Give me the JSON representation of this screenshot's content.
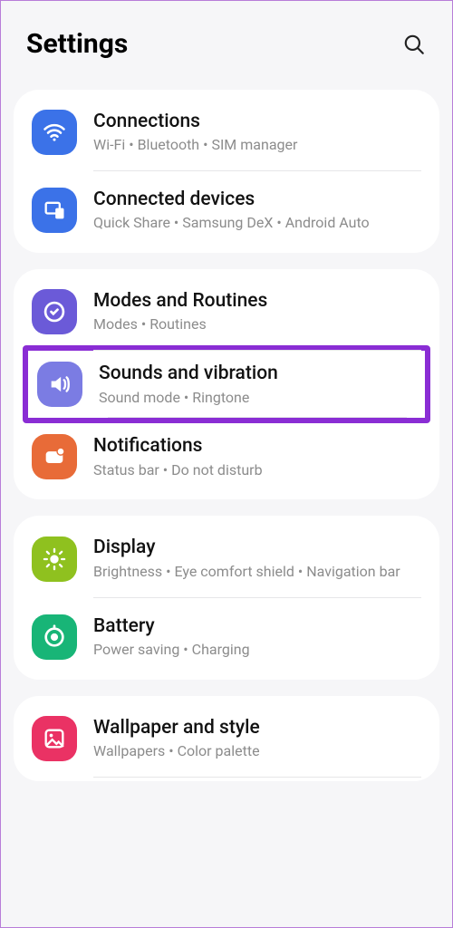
{
  "header": {
    "title": "Settings"
  },
  "groups": [
    {
      "items": [
        {
          "title": "Connections",
          "subtitle": "Wi-Fi  •  Bluetooth  •  SIM manager"
        },
        {
          "title": "Connected devices",
          "subtitle": "Quick Share  •  Samsung DeX  •  Android Auto"
        }
      ]
    },
    {
      "items": [
        {
          "title": "Modes and Routines",
          "subtitle": "Modes  •  Routines"
        },
        {
          "title": "Sounds and vibration",
          "subtitle": "Sound mode  •  Ringtone"
        },
        {
          "title": "Notifications",
          "subtitle": "Status bar  •  Do not disturb"
        }
      ]
    },
    {
      "items": [
        {
          "title": "Display",
          "subtitle": "Brightness  •  Eye comfort shield  •  Navigation bar"
        },
        {
          "title": "Battery",
          "subtitle": "Power saving  •  Charging"
        }
      ]
    },
    {
      "items": [
        {
          "title": "Wallpaper and style",
          "subtitle": "Wallpapers  •  Color palette"
        }
      ]
    }
  ],
  "colors": {
    "connections": "#3b72e8",
    "connectedDevices": "#3b72e8",
    "modes": "#6b5ad8",
    "sounds": "#7b7ce3",
    "notifications": "#e86b38",
    "display": "#8fc11f",
    "battery": "#18b577",
    "wallpaper": "#ea3264"
  }
}
